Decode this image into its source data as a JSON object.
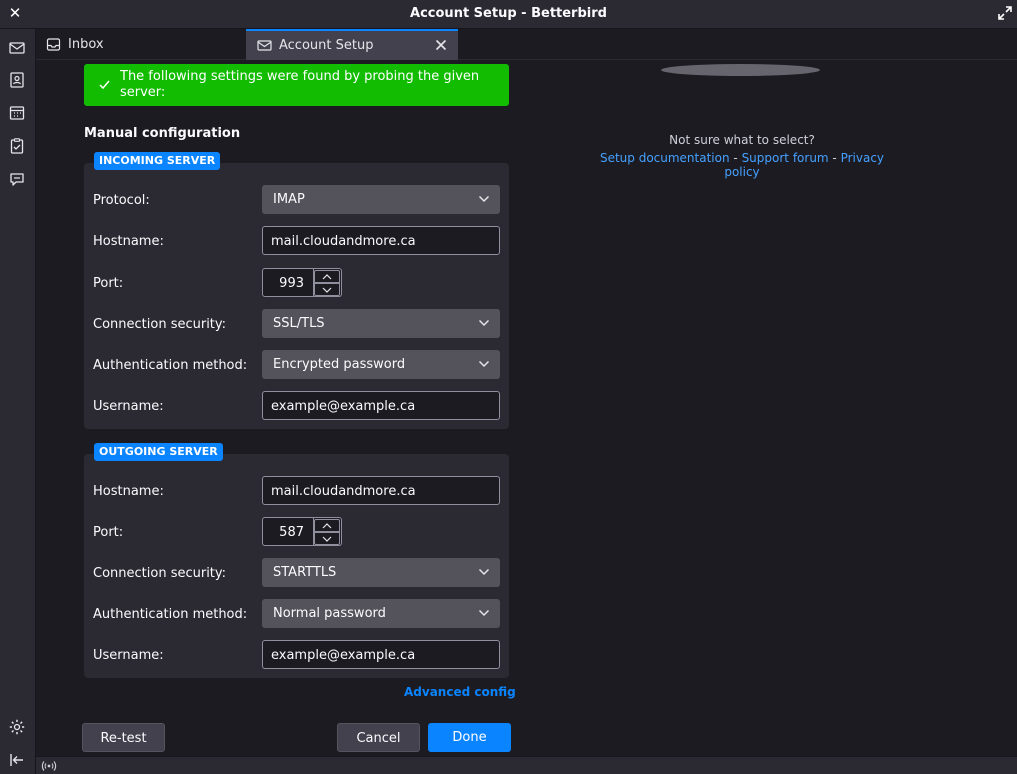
{
  "window": {
    "title": "Account Setup - Betterbird"
  },
  "tabs": [
    {
      "label": "Inbox",
      "icon": "inbox-tray-icon"
    },
    {
      "label": "Account Setup",
      "icon": "mail-envelope-icon"
    }
  ],
  "spaces": [
    "mail-icon",
    "address-book-icon",
    "calendar-icon",
    "tasks-icon",
    "chat-icon",
    "settings-gear-icon",
    "collapse-sidebar-icon"
  ],
  "banner": {
    "text": "The following settings were found by probing the given server:"
  },
  "manual": {
    "title": "Manual configuration"
  },
  "incoming": {
    "legend": "INCOMING SERVER",
    "protocol_label": "Protocol:",
    "protocol": "IMAP",
    "hostname_label": "Hostname:",
    "hostname": "mail.cloudandmore.ca",
    "port_label": "Port:",
    "port": "993",
    "security_label": "Connection security:",
    "security": "SSL/TLS",
    "auth_label": "Authentication method:",
    "auth": "Encrypted password",
    "username_label": "Username:",
    "username": "example@example.ca"
  },
  "outgoing": {
    "legend": "OUTGOING SERVER",
    "hostname_label": "Hostname:",
    "hostname": "mail.cloudandmore.ca",
    "port_label": "Port:",
    "port": "587",
    "security_label": "Connection security:",
    "security": "STARTTLS",
    "auth_label": "Authentication method:",
    "auth": "Normal password",
    "username_label": "Username:",
    "username": "example@example.ca"
  },
  "advanced": "Advanced config",
  "help": {
    "question": "Not sure what to select?",
    "setup_docs": "Setup documentation",
    "sep1": " - ",
    "support": "Support forum",
    "sep2": " - ",
    "privacy": "Privacy policy"
  },
  "buttons": {
    "retest": "Re-test",
    "cancel": "Cancel",
    "done": "Done"
  },
  "colors": {
    "accent": "#0a84ff",
    "success": "#12bc00",
    "background": "#1c1b22",
    "panel": "#2b2a33"
  }
}
